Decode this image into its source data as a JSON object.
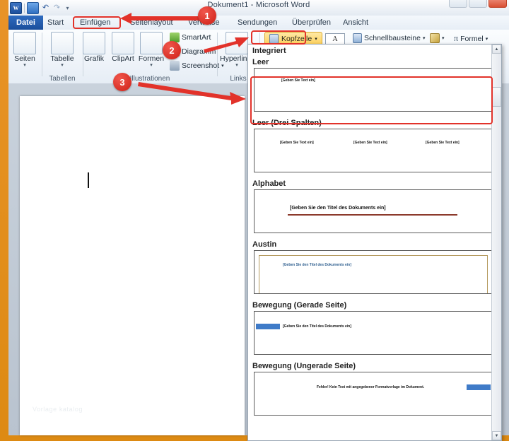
{
  "window": {
    "title": "Dokument1 - Microsoft Word",
    "minimize_label": "–",
    "restore_label": "❐",
    "close_label": "×"
  },
  "quick_access": {
    "app_logo": "W",
    "save_label": "save-icon",
    "undo_label": "↶",
    "redo_label": "↷",
    "customize_label": "▾"
  },
  "tabs": [
    {
      "label": "Datei"
    },
    {
      "label": "Start"
    },
    {
      "label": "Einfügen"
    },
    {
      "label": "Seitenlayout"
    },
    {
      "label": "Verweise"
    },
    {
      "label": "Sendungen"
    },
    {
      "label": "Überprüfen"
    },
    {
      "label": "Ansicht"
    }
  ],
  "ribbon": {
    "groups": [
      {
        "label": "Seiten"
      },
      {
        "label": "Tabellen"
      },
      {
        "label": "Illustrationen"
      },
      {
        "label": "Links"
      }
    ],
    "big_buttons": [
      {
        "label": "Seiten",
        "caret": "▾"
      },
      {
        "label": "Tabelle",
        "caret": "▾"
      },
      {
        "label": "Grafik",
        "caret": ""
      },
      {
        "label": "ClipArt",
        "caret": ""
      },
      {
        "label": "Formen",
        "caret": "▾"
      },
      {
        "label": "Hyperlinks",
        "caret": "▾"
      }
    ],
    "small_buttons": [
      {
        "label": "SmartArt"
      },
      {
        "label": "Diagramm"
      },
      {
        "label": "Screenshot",
        "caret": "▾"
      }
    ],
    "header_button": {
      "label": "Kopfzeile",
      "caret": "▾"
    },
    "text_group": [
      {
        "label": "Schnellbausteine",
        "caret": "▾"
      },
      {
        "label": "wordart",
        "caret": "▾"
      },
      {
        "label": "Formel",
        "caret": "▾"
      }
    ],
    "textbox_label": "A"
  },
  "document": {
    "watermark": "Vorlage katalog"
  },
  "gallery": {
    "section_title": "Integriert",
    "scroll_up": "▲",
    "scroll_down": "▼",
    "items": [
      {
        "name": "Leer",
        "placeholders": [
          "[Geben Sie Text ein]"
        ]
      },
      {
        "name": "Leer (Drei Spalten)",
        "placeholders": [
          "[Geben Sie Text ein]",
          "[Geben Sie Text ein]",
          "[Geben Sie Text ein]"
        ]
      },
      {
        "name": "Alphabet",
        "placeholders": [
          "[Geben Sie den Titel des Dokuments ein]"
        ]
      },
      {
        "name": "Austin",
        "placeholders": [
          "[Geben Sie den Titel des Dokuments ein]"
        ]
      },
      {
        "name": "Bewegung (Gerade Seite)",
        "placeholders": [
          "[Geben Sie den Titel des Dokuments ein]"
        ]
      },
      {
        "name": "Bewegung (Ungerade Seite)",
        "placeholders": [
          "Fehler! Kein Text mit angegebener Formatvorlage im Dokument."
        ]
      }
    ]
  },
  "annotations": {
    "badges": [
      {
        "number": "1"
      },
      {
        "number": "2"
      },
      {
        "number": "3"
      }
    ],
    "accent_color": "#e2322a"
  }
}
